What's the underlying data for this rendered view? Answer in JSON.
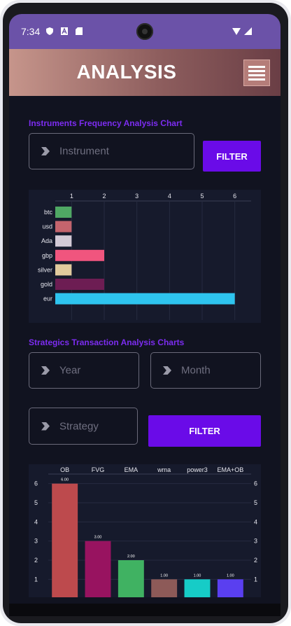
{
  "status": {
    "time": "7:34"
  },
  "header": {
    "title": "ANALYSIS"
  },
  "section1": {
    "title": "Instruments Frequency Analysis Chart",
    "instrument_placeholder": "Instrument",
    "filter_label": "FILTER"
  },
  "section2": {
    "title": "Strategics Transaction Analysis Charts",
    "year_placeholder": "Year",
    "month_placeholder": "Month",
    "strategy_placeholder": "Strategy",
    "filter_label": "FILTER"
  },
  "chart_data": [
    {
      "type": "bar",
      "orientation": "horizontal",
      "categories": [
        "btc",
        "usd",
        "Ada",
        "gbp",
        "silver",
        "gold",
        "eur"
      ],
      "values": [
        0.5,
        0.5,
        0.5,
        1.5,
        0.5,
        1.5,
        5.5
      ],
      "colors": [
        "#4fa864",
        "#c4646d",
        "#d3cad6",
        "#f0557e",
        "#e1cb9d",
        "#6d1d53",
        "#2ec4ef"
      ],
      "xticks": [
        "1",
        "2",
        "3",
        "4",
        "5",
        "6"
      ],
      "xlim": [
        0.5,
        6.5
      ],
      "grid": true
    },
    {
      "type": "bar",
      "categories": [
        "OB",
        "FVG",
        "EMA",
        "wma",
        "power3",
        "EMA+OB"
      ],
      "values": [
        6,
        3,
        2,
        1,
        1,
        1
      ],
      "value_labels": [
        "6.00",
        "3.00",
        "2.00",
        "1.00",
        "1.00",
        "1.00"
      ],
      "colors": [
        "#bd4a4d",
        "#981360",
        "#40b262",
        "#8d5a58",
        "#16ccc7",
        "#5a3ff0"
      ],
      "yticks": [
        "1",
        "2",
        "3",
        "4",
        "5",
        "6"
      ],
      "ylim": [
        0.5,
        6.5
      ],
      "grid": true
    }
  ]
}
